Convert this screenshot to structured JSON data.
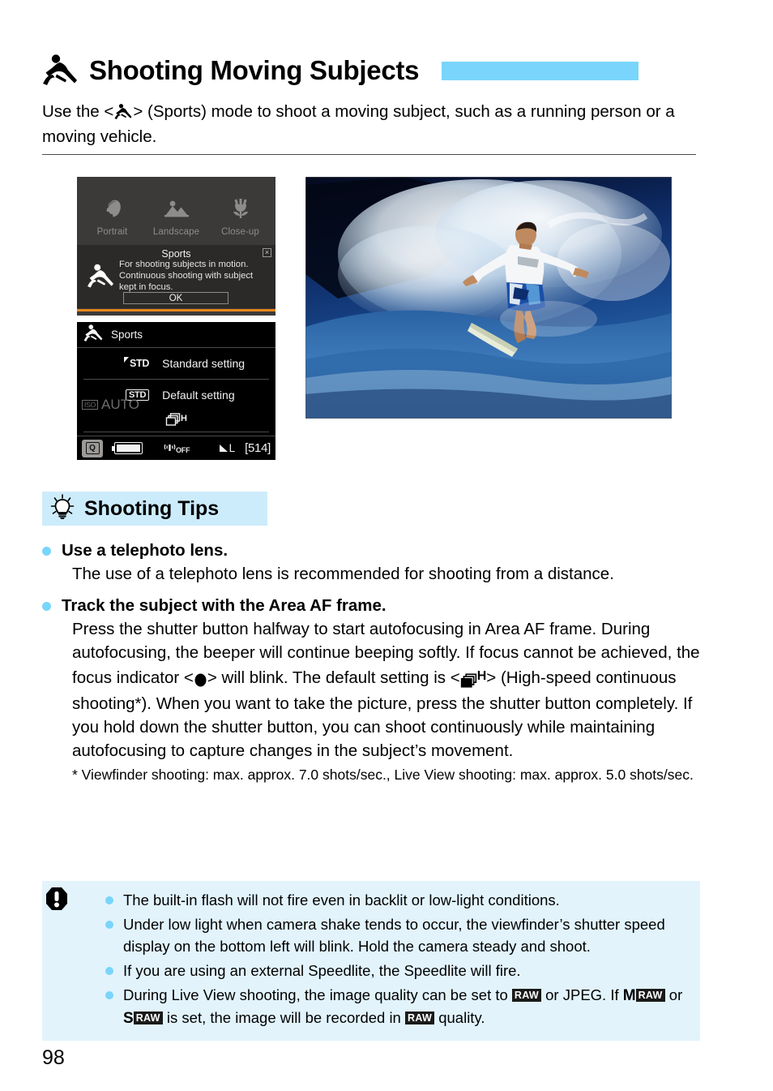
{
  "page": {
    "number": "98",
    "accent_blue": "#79d5fb",
    "tips_header_bg": "#cdecfb",
    "caution_bg": "#e2f3fc",
    "orange_accent": "#e8861d"
  },
  "header": {
    "icon": "sports-runner-icon",
    "title": "Shooting Moving Subjects"
  },
  "intro": {
    "part1": "Use the <",
    "icon": "sports-runner-icon",
    "part2": "> (Sports) mode to shoot a moving subject, such as a running person or a moving vehicle."
  },
  "figure_mode_select": {
    "modes": [
      {
        "icon": "portrait-icon",
        "label": "Portrait"
      },
      {
        "icon": "landscape-icon",
        "label": "Landscape"
      },
      {
        "icon": "closeup-flower-icon",
        "label": "Close-up"
      }
    ],
    "dialog": {
      "title": "Sports",
      "close": "×",
      "icon": "sports-runner-icon",
      "body": "For shooting subjects in motion. Continuous shooting with subject kept in focus.",
      "ok_label": "OK"
    }
  },
  "figure_settings_screen": {
    "mode_icon": "sports-runner-icon",
    "mode_label": "Sports",
    "rows": [
      {
        "badge": "STD",
        "badge_style": "flag",
        "label": "Standard setting"
      },
      {
        "badge": "STD",
        "badge_style": "box",
        "label": "Default setting"
      }
    ],
    "iso": {
      "badge": "ISO",
      "value": "AUTO"
    },
    "drive_mode": {
      "icon": "continuous-shooting-icon",
      "suffix": "H"
    },
    "status_bar": {
      "q_button": "Q",
      "battery": "battery-full-icon",
      "wifi": "wifi-off-icon",
      "wifi_label": "OFF",
      "quality": "L",
      "shots_remaining": "[514]"
    }
  },
  "photo": {
    "alt": "surfer-riding-wave-photo"
  },
  "tips": {
    "header": "Shooting Tips",
    "header_icon": "lightbulb-icon",
    "items": [
      {
        "heading": "Use a telephoto lens.",
        "body": "The use of a telephoto lens is recommended for shooting from a distance."
      },
      {
        "heading": "Track the subject with the Area AF frame.",
        "body_1": "Press the shutter button halfway to start autofocusing in Area AF frame. During autofocusing, the beeper will continue beeping softly. If focus cannot be achieved, the focus indicator <",
        "focus_icon": "focus-confirmation-dot-icon",
        "body_2": "> will blink. The default setting is <",
        "drive_icon": "continuous-shooting-icon",
        "drive_suffix": "H",
        "body_3": "> (High-speed continuous shooting*). When you want to take the picture, press the shutter button completely. If you hold down the shutter button, you can shoot continuously while maintaining autofocusing to capture changes in the subject’s movement.",
        "footnote": "* Viewfinder shooting: max. approx. 7.0 shots/sec., Live View shooting: max. approx. 5.0 shots/sec."
      }
    ]
  },
  "caution": {
    "icon": "warning-exclamation-icon",
    "items": [
      {
        "text": "The built-in flash will not fire even in backlit or low-light conditions."
      },
      {
        "text": "Under low light when camera shake tends to occur, the viewfinder’s shutter speed display on the bottom left will blink. Hold the camera steady and shoot."
      },
      {
        "text": "If you are using an external Speedlite, the Speedlite will fire."
      },
      {
        "text_1": "During Live View shooting, the image quality can be set to ",
        "raw_1": "RAW",
        "text_2": " or JPEG. If ",
        "m_label": "M",
        "raw_2": "RAW",
        "text_3": " or ",
        "s_label": "S",
        "raw_3": "RAW",
        "text_4": " is set, the image will be recorded in ",
        "raw_4": "RAW",
        "text_5": " quality."
      }
    ]
  }
}
